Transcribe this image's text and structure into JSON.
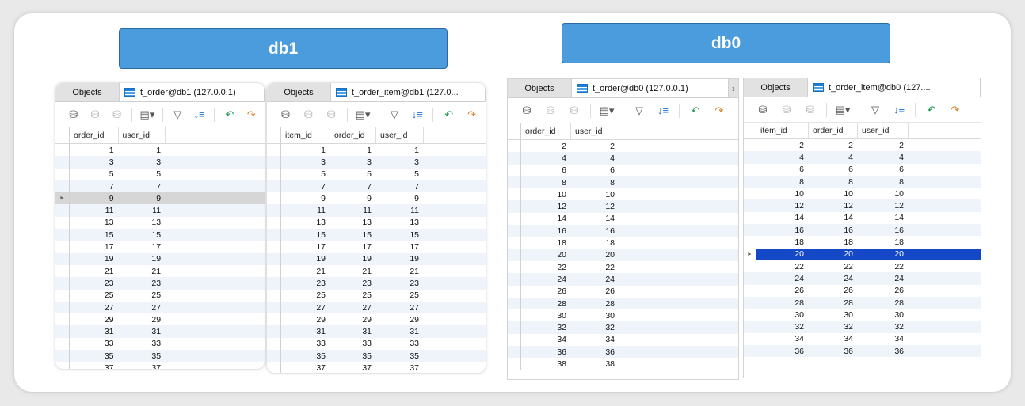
{
  "banners": {
    "left": "db1",
    "right": "db0"
  },
  "colors": {
    "banner": "#4b9cdc",
    "selected_row": "#1448c6"
  },
  "toolbar_icons": [
    "begin-transaction-icon",
    "text-icon",
    "filter-wizard-icon",
    "document-dropdown-icon",
    "filter-icon",
    "sort-icon",
    "import-icon",
    "export-icon"
  ],
  "windows": [
    {
      "objects_tab": "Objects",
      "active_tab": "t_order@db1 (127.0.0.1)",
      "columns": [
        "order_id",
        "user_id"
      ],
      "rows": [
        [
          1,
          1
        ],
        [
          3,
          3
        ],
        [
          5,
          5
        ],
        [
          7,
          7
        ],
        [
          9,
          9
        ],
        [
          11,
          11
        ],
        [
          13,
          13
        ],
        [
          15,
          15
        ],
        [
          17,
          17
        ],
        [
          19,
          19
        ],
        [
          21,
          21
        ],
        [
          23,
          23
        ],
        [
          25,
          25
        ],
        [
          27,
          27
        ],
        [
          29,
          29
        ],
        [
          31,
          31
        ],
        [
          33,
          33
        ],
        [
          35,
          35
        ],
        [
          37,
          37
        ]
      ],
      "selected_row": 4
    },
    {
      "objects_tab": "Objects",
      "active_tab": "t_order_item@db1 (127.0...",
      "columns": [
        "item_id",
        "order_id",
        "user_id"
      ],
      "rows": [
        [
          1,
          1,
          1
        ],
        [
          3,
          3,
          3
        ],
        [
          5,
          5,
          5
        ],
        [
          7,
          7,
          7
        ],
        [
          9,
          9,
          9
        ],
        [
          11,
          11,
          11
        ],
        [
          13,
          13,
          13
        ],
        [
          15,
          15,
          15
        ],
        [
          17,
          17,
          17
        ],
        [
          19,
          19,
          19
        ],
        [
          21,
          21,
          21
        ],
        [
          23,
          23,
          23
        ],
        [
          25,
          25,
          25
        ],
        [
          27,
          27,
          27
        ],
        [
          29,
          29,
          29
        ],
        [
          31,
          31,
          31
        ],
        [
          33,
          33,
          33
        ],
        [
          35,
          35,
          35
        ],
        [
          37,
          37,
          37
        ]
      ],
      "selected_row": -1
    },
    {
      "objects_tab": "Objects",
      "active_tab": "t_order@db0 (127.0.0.1)",
      "more_tab": "›",
      "columns": [
        "order_id",
        "user_id"
      ],
      "rows": [
        [
          2,
          2
        ],
        [
          4,
          4
        ],
        [
          6,
          6
        ],
        [
          8,
          8
        ],
        [
          10,
          10
        ],
        [
          12,
          12
        ],
        [
          14,
          14
        ],
        [
          16,
          16
        ],
        [
          18,
          18
        ],
        [
          20,
          20
        ],
        [
          22,
          22
        ],
        [
          24,
          24
        ],
        [
          26,
          26
        ],
        [
          28,
          28
        ],
        [
          30,
          30
        ],
        [
          32,
          32
        ],
        [
          34,
          34
        ],
        [
          36,
          36
        ],
        [
          38,
          38
        ]
      ],
      "selected_row": -1
    },
    {
      "objects_tab": "Objects",
      "active_tab": "t_order_item@db0 (127....",
      "columns": [
        "item_id",
        "order_id",
        "user_id"
      ],
      "rows": [
        [
          2,
          2,
          2
        ],
        [
          4,
          4,
          4
        ],
        [
          6,
          6,
          6
        ],
        [
          8,
          8,
          8
        ],
        [
          10,
          10,
          10
        ],
        [
          12,
          12,
          12
        ],
        [
          14,
          14,
          14
        ],
        [
          16,
          16,
          16
        ],
        [
          18,
          18,
          18
        ],
        [
          20,
          20,
          20
        ],
        [
          22,
          22,
          22
        ],
        [
          24,
          24,
          24
        ],
        [
          26,
          26,
          26
        ],
        [
          28,
          28,
          28
        ],
        [
          30,
          30,
          30
        ],
        [
          32,
          32,
          32
        ],
        [
          34,
          34,
          34
        ],
        [
          36,
          36,
          36
        ]
      ],
      "selected_row": 9
    }
  ]
}
